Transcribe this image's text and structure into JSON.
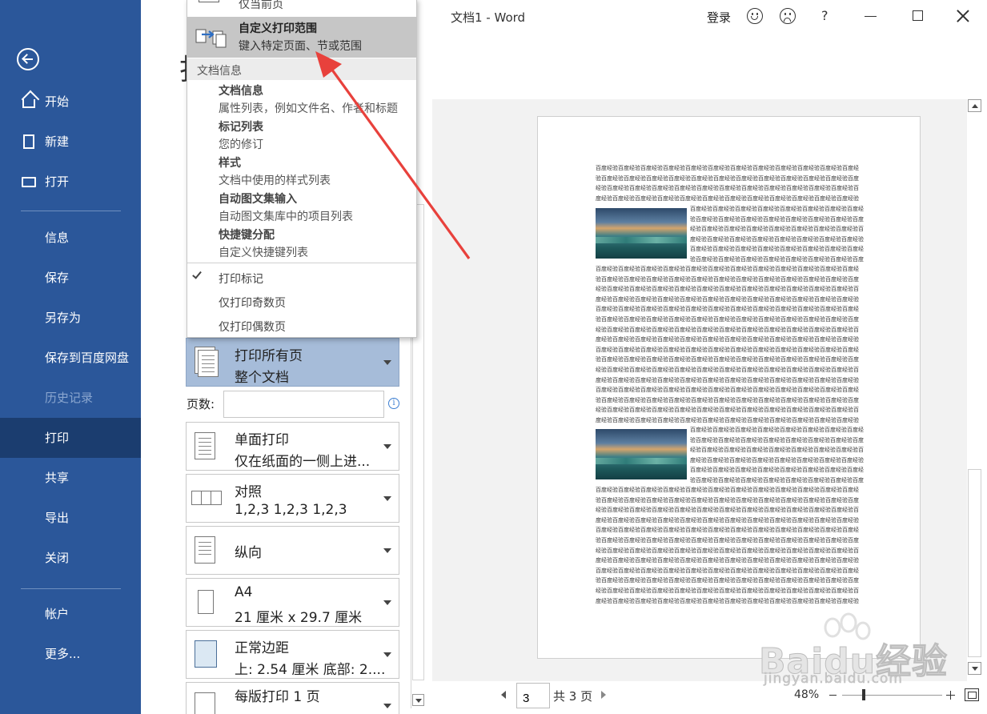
{
  "window": {
    "title": "文档1  -  Word",
    "login": "登录",
    "help": "?"
  },
  "nav": {
    "items": [
      {
        "label": "开始",
        "icon": "home-icon"
      },
      {
        "label": "新建",
        "icon": "new-document-icon"
      },
      {
        "label": "打开",
        "icon": "open-folder-icon"
      },
      {
        "label": "信息"
      },
      {
        "label": "保存"
      },
      {
        "label": "另存为"
      },
      {
        "label": "保存到百度网盘"
      },
      {
        "label": "历史记录",
        "disabled": true
      },
      {
        "label": "打印",
        "active": true
      },
      {
        "label": "共享"
      },
      {
        "label": "导出"
      },
      {
        "label": "关闭"
      },
      {
        "label": "帐户"
      },
      {
        "label": "更多..."
      }
    ]
  },
  "partial_title": "打",
  "dropdown": {
    "top_item": "仅当前页",
    "custom": {
      "title": "自定义打印范围",
      "desc": "键入特定页面、节或范围"
    },
    "section_header": "文档信息",
    "entries": [
      {
        "title": "文档信息",
        "desc": "属性列表，例如文件名、作者和标题"
      },
      {
        "title": "标记列表",
        "desc": "您的修订"
      },
      {
        "title": "样式",
        "desc": "文档中使用的样式列表"
      },
      {
        "title": "自动图文集输入",
        "desc": "自动图文集库中的项目列表"
      },
      {
        "title": "快捷键分配",
        "desc": "自定义快捷键列表"
      }
    ],
    "options": [
      {
        "label": "打印标记",
        "checked": true
      },
      {
        "label": "仅打印奇数页",
        "checked": false
      },
      {
        "label": "仅打印偶数页",
        "checked": false
      }
    ]
  },
  "settings": {
    "print_range": {
      "line1": "打印所有页",
      "line2": "整个文档"
    },
    "pages_label": "页数:",
    "pages_value": "",
    "pages_info": "i",
    "sides": {
      "line1": "单面打印",
      "line2": "仅在纸面的一侧上进..."
    },
    "collate": {
      "line1": "对照",
      "line2": "1,2,3     1,2,3     1,2,3"
    },
    "orientation": {
      "line1": "纵向"
    },
    "paper": {
      "line1": "A4",
      "line2": "21 厘米 x 29.7 厘米"
    },
    "margins": {
      "line1": "正常边距",
      "line2": "上: 2.54 厘米 底部: 2...."
    },
    "per_sheet": {
      "line1": "每版打印 1 页"
    }
  },
  "preview": {
    "filler_text": "百度经验百度经验百度经验百度经验百度经验百度经验百度经验百度经验百度经验百度经验百度经验百度经验百度经验百度经验百度经验百度经验百度经验百度经验百度经验百度经验百度经验百度经验百度经验百度经验百度经验百度经验百度经验百度经验百度经验百度经验百度经验百度经验百度经验百度经验百度经验百度经验百度经验百度经验百度经验百度经验百度经验百度经验百度经验百度经验百度经验百度经验百度经验百度经验百度经验百度经验百度经验百度经验百度经验百度经验百度经验百度经验百度经验百度经验百度经验百度经验百度经验百度经验百度经验百度经验百度经验百度经验百度经验百度经验百度经验百度经验百度经验百度经验百度经验百度经验百度经验百度经验百度经验百度经验百度经验百度经验百度经验百度经验百度经验百度经验百度经验百度经验百度经验百度经验百度经验百度经验百度经验百度经验百度经验百度经验百度经验百度经验百度经验百度经验百度经验百度经验百度经验百度经验百度经验百度经验百度经验百度经验百度经验百度经验百度经验百度经验百度经验百度经验百度经验百度经验百度经验百度经验百度经验百度经验百度经验百度经验百度经验百度经验百度经验百度经验百度经验百度经验百度经验百度经验百度经验百度经验百度经验百度经验百度经验百度经验百度经验百度经验百度经验百度经验百度经验百度经验百度经验百度经验百度经验百度经验百度经验百度经验百度经验百度经验百度经验百度经验百度经验百度经验百度经验百度经验百度经验百度经验百度经验百度经验百度经验百度经验百度经验百度经验百度经验百度经验百度经验百度经验百度经验百度经验百度经验百度经验百度经验百度经验百度经验百度经验百度经验百度经验百度经验百度经验百度经验百度经验百度经验百度经验百度经验百度经验百度经验百度经验百度经验百度经验百度经验百度经验百度经验百度经验百度经验百度经验百度经验百度经验百度经验百度经验百度经验百度经验百度经验百度经验百度经验百度经验百度经验百度经验百度经验百度经验百度经验百度经验百度经验百度经验百度经验百度经验百度经验百度经验百度经验百度经验百度经验百度经验百度经验百度经验百度经验百度经验百度经验百度经验百度经验百度经验百度经验百度经验百度经验百度经验百度经验百度经验百度经验百度经验百度经验百度经验百度经验百度经验百度经验百度经验百度经验百度经验百度经验百度经验百度经验百度经验百度经验百度经验百度经验百度经验百度经验百度经验百度经验百度经验百度经验百度经验百度经验百度经验百度经验百度经验百度经验百度经验百度经验百度经验百度经验百度经验百度经验百度经验百度经验百度经验百度经验百度经验百度经验百度经验百度经验百度经验百度经验百度经验百度经验百度经验百度经验百度经验百度经验百度经验百度经验百度经验百度经验百度经验百度经验百度经验百度经验百度经验百度经验百度经验百度经验百度经验百度经验百度经验百度经验百度经验百度经验百度经验百度经验百度经验百度经验百度经验百度经验百度经验百度经验百度经验百度经验百度经验百度经验百度经验百度经验百度经验百度经验百度经验百度经验百度经验百度经验百度经验百度经验百度经验百度经验百度经验百度经验百度经验百度经验百度经验百度经验百度经验百度经验百度经验百度经验百度经验百度经验百度经验百度经验百度经验百度经验百度经验百度经验百度经验百度经验百度经验百度经验百度经验百度经验百度经验百度经验百度经验百度经验百度经验百度经验",
    "current_page": "3",
    "total_pages": "共 3 页",
    "zoom": "48%"
  },
  "watermark": {
    "text": "Baidu经验",
    "url": "jingyan.baidu.com"
  },
  "colors": {
    "nav_bg": "#2b579a",
    "nav_active": "#1b3d6f",
    "selected_setting": "#a6bcd9",
    "arrow": "#e8413c"
  }
}
